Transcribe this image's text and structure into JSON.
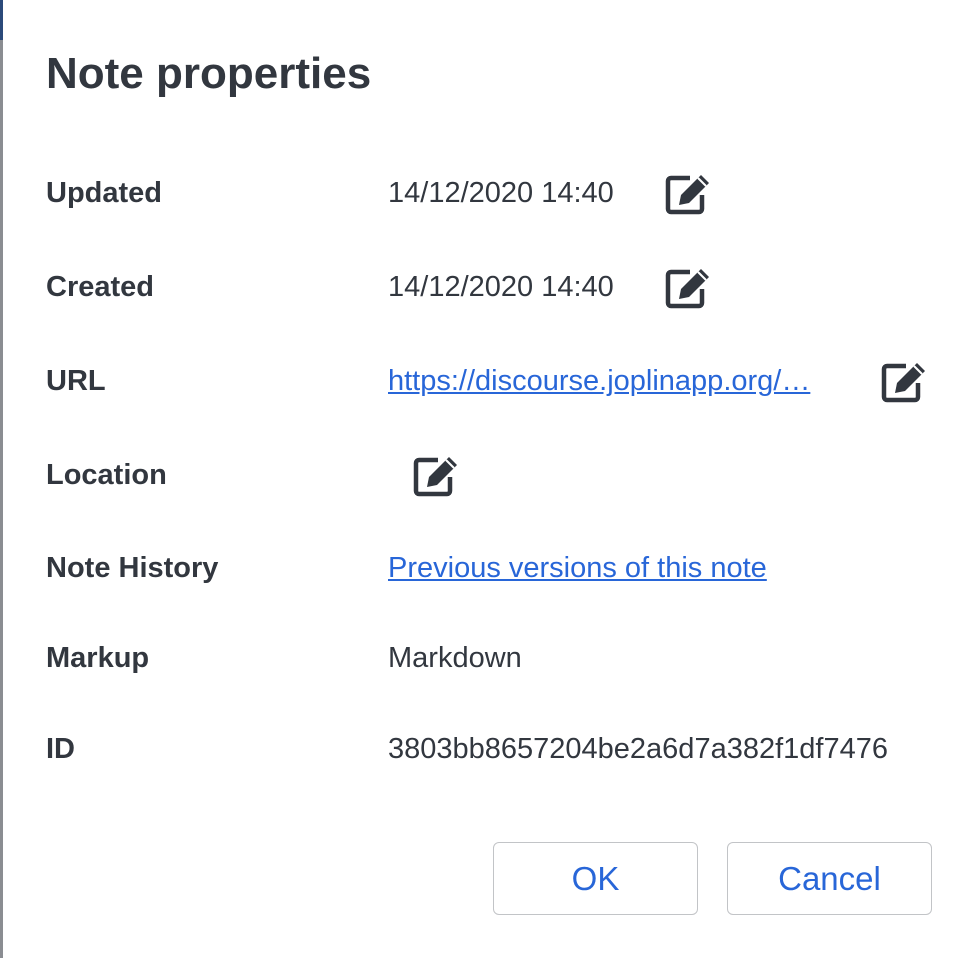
{
  "dialog": {
    "title": "Note properties"
  },
  "properties": {
    "updated": {
      "label": "Updated",
      "value": "14/12/2020 14:40"
    },
    "created": {
      "label": "Created",
      "value": "14/12/2020 14:40"
    },
    "url": {
      "label": "URL",
      "value": "https://discourse.joplinapp.org/…"
    },
    "location": {
      "label": "Location",
      "value": ""
    },
    "note_history": {
      "label": "Note History",
      "value": "Previous versions of this note"
    },
    "markup": {
      "label": "Markup",
      "value": "Markdown"
    },
    "id": {
      "label": "ID",
      "value": "3803bb8657204be2a6d7a382f1df7476"
    }
  },
  "buttons": {
    "ok_label": "OK",
    "cancel_label": "Cancel"
  },
  "icons": {
    "edit": "edit-icon"
  },
  "colors": {
    "text": "#32373f",
    "link": "#2866d8",
    "button_border": "#c2c4c7"
  }
}
